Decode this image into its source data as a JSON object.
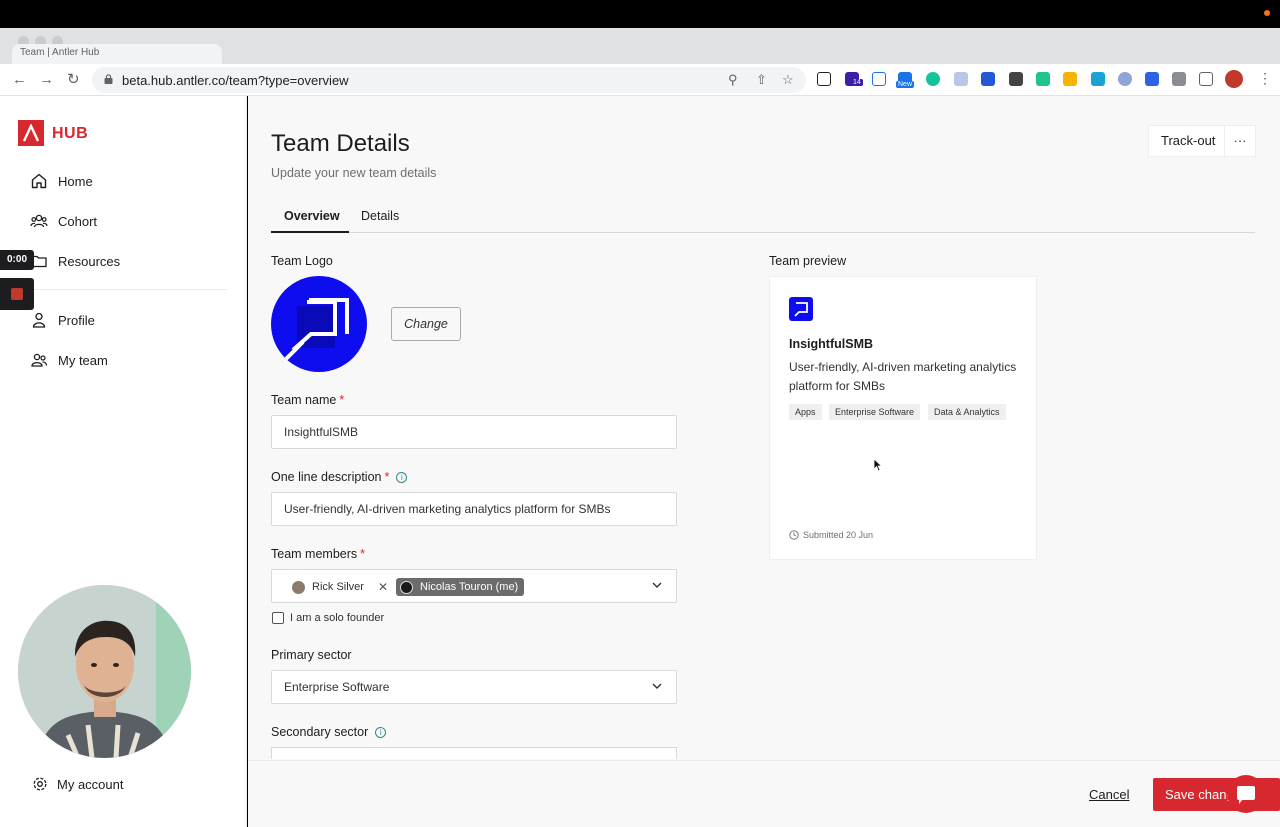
{
  "browser": {
    "tab_title": "Team | Antler Hub",
    "url": "beta.hub.antler.co/team?type=overview",
    "ext_badge_count": "14",
    "ext_badge_new": "New"
  },
  "recording": {
    "timer": "0:00"
  },
  "sidebar": {
    "logo_text": "HUB",
    "items": [
      {
        "label": "Home",
        "icon": "home-icon"
      },
      {
        "label": "Cohort",
        "icon": "users-icon"
      },
      {
        "label": "Resources",
        "icon": "folder-icon"
      },
      {
        "label": "Profile",
        "icon": "user-icon"
      },
      {
        "label": "My team",
        "icon": "team-icon"
      }
    ],
    "account_label": "My account"
  },
  "header": {
    "title": "Team Details",
    "subtitle": "Update your new team details",
    "trackout_label": "Track-out",
    "more_label": "···"
  },
  "tabs": [
    {
      "label": "Overview",
      "active": true
    },
    {
      "label": "Details",
      "active": false
    }
  ],
  "form": {
    "logo_label": "Team Logo",
    "change_label": "Change",
    "team_name_label": "Team name",
    "team_name_value": "InsightfulSMB",
    "description_label": "One line description",
    "description_value": "User-friendly, AI-driven marketing analytics platform for SMBs",
    "members_label": "Team members",
    "members": [
      "Rick Silver",
      "Nicolas Touron (me)"
    ],
    "solo_label": "I am a solo founder",
    "primary_sector_label": "Primary sector",
    "primary_sector_value": "Enterprise Software",
    "secondary_sector_label": "Secondary sector",
    "required_mark": "*",
    "info_mark": "i"
  },
  "preview": {
    "label": "Team preview",
    "name": "InsightfulSMB",
    "description": "User-friendly, AI-driven marketing analytics platform for SMBs",
    "tags": [
      "Apps",
      "Enterprise Software",
      "Data & Analytics"
    ],
    "submitted": "Submitted 20 Jun"
  },
  "footer": {
    "cancel_label": "Cancel",
    "save_label": "Save changes"
  },
  "colors": {
    "brand_red": "#d7282f",
    "logo_blue": "#0d0df0"
  }
}
